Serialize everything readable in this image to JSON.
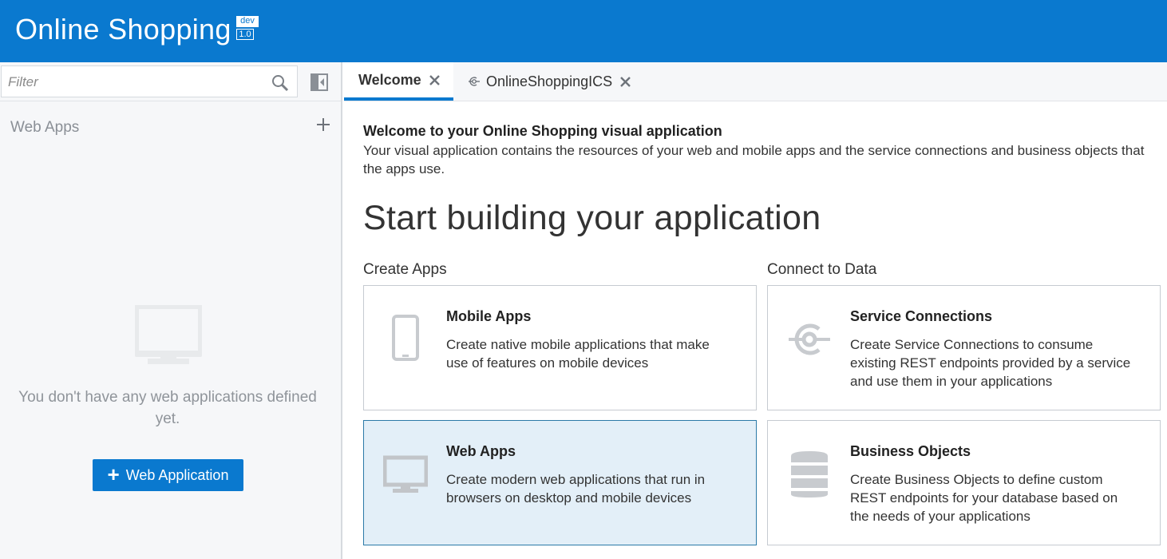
{
  "header": {
    "title": "Online Shopping",
    "env_badge": "dev",
    "version": "1.0",
    "background_color": "#0a79cf"
  },
  "sidebar": {
    "filter_placeholder": "Filter",
    "section_title": "Web Apps",
    "empty_message": "You don't have any web applications defined yet.",
    "add_button_label": "Web Application",
    "icons": [
      "search-icon",
      "collapse-panel-icon",
      "add-icon",
      "monitor-icon"
    ]
  },
  "tabs": [
    {
      "label": "Welcome",
      "active": true
    },
    {
      "label": "OnlineShoppingICS",
      "active": false,
      "icon": "service-connection-icon"
    }
  ],
  "main": {
    "welcome_title": "Welcome to your Online Shopping visual application",
    "welcome_desc": "Your visual application contains the resources of your web and mobile apps and the service connections and business objects that the apps use.",
    "headline": "Start building your application",
    "create_label": "Create Apps",
    "connect_label": "Connect to Data",
    "cards": [
      {
        "title": "Mobile Apps",
        "desc": "Create native mobile applications that make use of features on mobile devices",
        "icon": "mobile-icon",
        "selected": false
      },
      {
        "title": "Service Connections",
        "desc": "Create Service Connections to consume existing REST endpoints provided by a service and use them in your applications",
        "icon": "service-connection-icon",
        "selected": false
      },
      {
        "title": "Web Apps",
        "desc": "Create modern web applications that run in browsers on desktop and mobile devices",
        "icon": "monitor-icon",
        "selected": true
      },
      {
        "title": "Business Objects",
        "desc": "Create Business Objects to define custom REST endpoints for your database based on the needs of your applications",
        "icon": "database-icon",
        "selected": false
      }
    ]
  }
}
